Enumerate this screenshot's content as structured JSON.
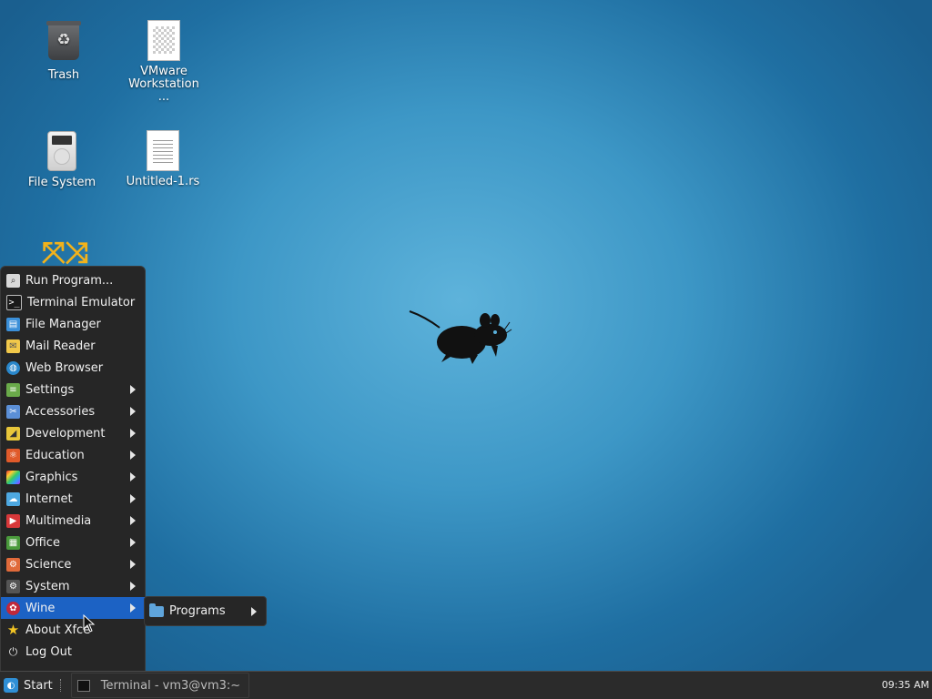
{
  "desktop": {
    "icons": [
      {
        "label": "Trash",
        "icon": "trash-icon"
      },
      {
        "label": "VMware Workstation ...",
        "icon": "document-icon"
      },
      {
        "label": "File System",
        "icon": "drive-icon"
      },
      {
        "label": "Untitled-1.rs",
        "icon": "text-file-icon"
      }
    ]
  },
  "menu": {
    "items": [
      {
        "label": "Run Program...",
        "icon": "search-icon"
      },
      {
        "label": "Terminal Emulator",
        "icon": "terminal-icon"
      },
      {
        "label": "File Manager",
        "icon": "file-manager-icon"
      },
      {
        "label": "Mail Reader",
        "icon": "mail-icon"
      },
      {
        "label": "Web Browser",
        "icon": "globe-icon"
      },
      {
        "label": "Settings",
        "icon": "settings-icon"
      },
      {
        "label": "Accessories",
        "icon": "accessories-icon"
      },
      {
        "label": "Development",
        "icon": "development-icon"
      },
      {
        "label": "Education",
        "icon": "education-icon"
      },
      {
        "label": "Graphics",
        "icon": "graphics-icon"
      },
      {
        "label": "Internet",
        "icon": "cloud-icon"
      },
      {
        "label": "Multimedia",
        "icon": "multimedia-icon"
      },
      {
        "label": "Office",
        "icon": "office-icon"
      },
      {
        "label": "Science",
        "icon": "science-icon"
      },
      {
        "label": "System",
        "icon": "gear-icon"
      },
      {
        "label": "Wine",
        "icon": "wine-icon"
      },
      {
        "label": "About Xfce",
        "icon": "star-icon"
      },
      {
        "label": "Log Out",
        "icon": "logout-icon"
      }
    ],
    "submenu": {
      "label": "Programs",
      "icon": "folder-icon"
    }
  },
  "taskbar": {
    "start_label": "Start",
    "task_label": "Terminal - vm3@vm3:~",
    "clock": "09:35 AM"
  },
  "colors": {
    "accent": "#1c62c4",
    "menu_bg": "#262626",
    "folder_yellow": "#f2b21b"
  }
}
